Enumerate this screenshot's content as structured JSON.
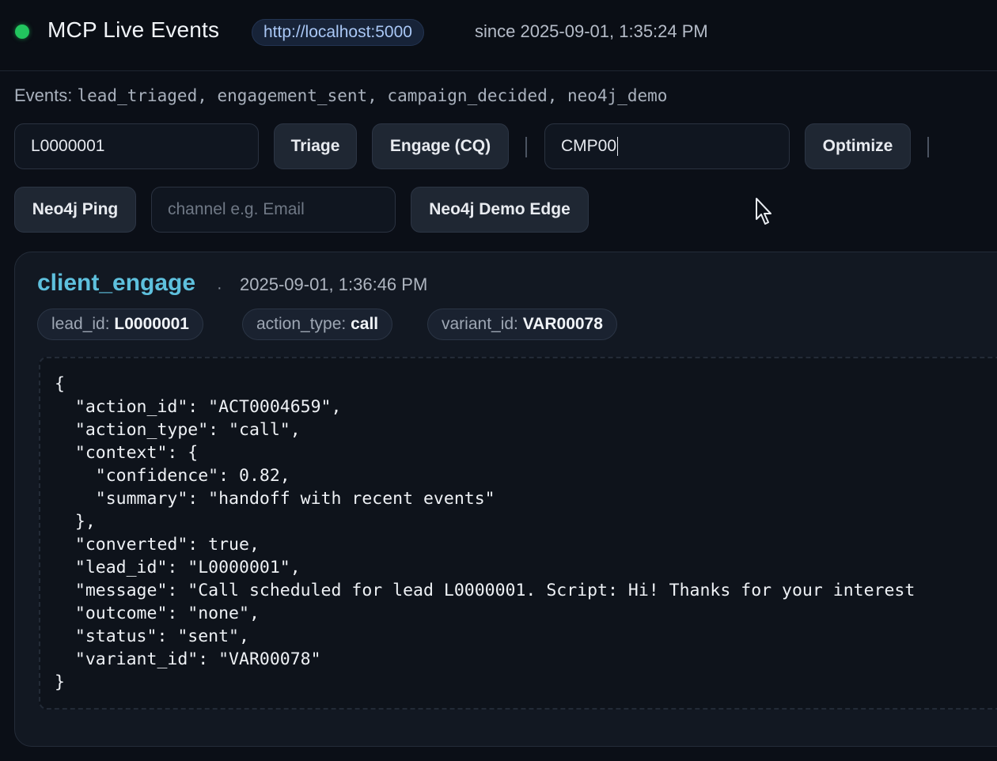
{
  "header": {
    "title": "MCP Live Events",
    "url": "http://localhost:5000",
    "since": "since 2025-09-01, 1:35:24 PM",
    "status_color": "#22c55e"
  },
  "events_line": {
    "label": "Events:",
    "list": "lead_triaged, engagement_sent, campaign_decided, neo4j_demo"
  },
  "controls": {
    "lead_input_value": "L0000001",
    "triage_label": "Triage",
    "engage_label": "Engage (CQ)",
    "campaign_input_value": "CMP00",
    "optimize_label": "Optimize",
    "neo4j_ping_label": "Neo4j Ping",
    "channel_placeholder": "channel e.g. Email",
    "neo4j_demo_edge_label": "Neo4j Demo Edge"
  },
  "event_card": {
    "name": "client_engage",
    "separator": "·",
    "timestamp": "2025-09-01, 1:36:46 PM",
    "chips": [
      {
        "key": "lead_id:",
        "value": "L0000001"
      },
      {
        "key": "action_type:",
        "value": "call"
      },
      {
        "key": "variant_id:",
        "value": "VAR00078"
      }
    ],
    "json_lines": [
      "{",
      "  \"action_id\": \"ACT0004659\",",
      "  \"action_type\": \"call\",",
      "  \"context\": {",
      "    \"confidence\": 0.82,",
      "    \"summary\": \"handoff with recent events\"",
      "  },",
      "  \"converted\": true,",
      "  \"lead_id\": \"L0000001\",",
      "  \"message\": \"Call scheduled for lead L0000001. Script: Hi! Thanks for your interest",
      "  \"outcome\": \"none\",",
      "  \"status\": \"sent\",",
      "  \"variant_id\": \"VAR00078\"",
      "}"
    ]
  },
  "colors": {
    "background": "#0b0f17",
    "accent_event_name": "#5ec0dd",
    "url_pill_text": "#a9c7f5"
  },
  "icons": {
    "status": "status-dot-icon",
    "cursor": "mouse-pointer-icon"
  }
}
